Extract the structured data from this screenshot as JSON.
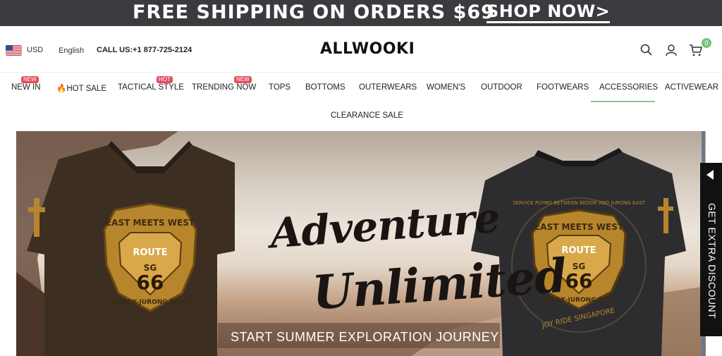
{
  "promo": {
    "text": "FREE SHIPPING ON ORDERS $69",
    "cta": "SHOP NOW>"
  },
  "header": {
    "currency": "USD",
    "language": "English",
    "contact": "CALL US:+1 877-725-2124",
    "logo": "ALLWOOKI",
    "cart_count": "0"
  },
  "nav": {
    "items": [
      {
        "label": "NEW IN",
        "badge": "New"
      },
      {
        "label": "🔥HOT SALE",
        "badge": ""
      },
      {
        "label": "TACTICAL STYLE",
        "badge": "Hot"
      },
      {
        "label": "TRENDING NOW",
        "badge": "New"
      },
      {
        "label": "TOPS",
        "badge": ""
      },
      {
        "label": "BOTTOMS",
        "badge": ""
      },
      {
        "label": "OUTERWEARS",
        "badge": ""
      },
      {
        "label": "WOMEN'S",
        "badge": ""
      },
      {
        "label": "OUTDOOR",
        "badge": ""
      },
      {
        "label": "FOOTWEARS",
        "badge": ""
      },
      {
        "label": "ACCESSORIES",
        "badge": ""
      },
      {
        "label": "ACTIVEWEAR",
        "badge": ""
      }
    ],
    "row2": "CLEARANCE SALE"
  },
  "banner": {
    "title_line1": "Adventure",
    "title_line2": "Unlimited",
    "subtitle": "START SUMMER EXPLORATION JOURNEY",
    "shirt_text": {
      "east_meets_west": "EAST MEETS WEST",
      "route": "ROUTE",
      "sg": "SG",
      "east": "EAST",
      "west": "WEST",
      "number": "66",
      "bedok_jurong": "BEDOK-JURONG EAST",
      "service": "SERVICE PLYING BETWEEN BEDOK AND JURONG EAST",
      "joy_ride": "JOY RIDE SINGAPORE"
    }
  },
  "side_tab": {
    "label": "GET EXTRA DISCOUNT"
  },
  "colors": {
    "promo_bg": "#3b3b3f",
    "badge_red": "#e34b5b",
    "cart_badge": "#7bc27a",
    "active_underline": "#8bc38f"
  },
  "icons": [
    "us-flag-icon",
    "search-icon",
    "user-icon",
    "cart-icon",
    "fire-icon",
    "chevron-left-icon"
  ]
}
